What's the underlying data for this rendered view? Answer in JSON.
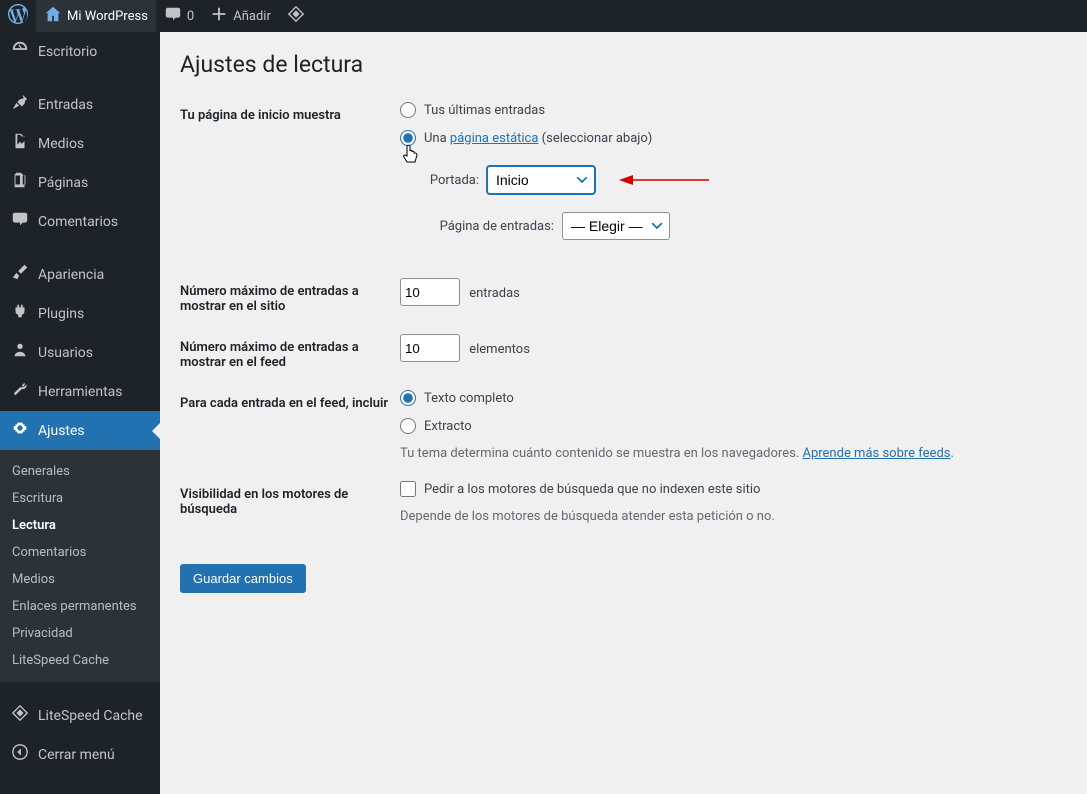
{
  "adminbar": {
    "wp_logo": "W",
    "site_name": "Mi WordPress",
    "comments_count": "0",
    "new_label": "Añadir"
  },
  "sidebar": {
    "items": [
      {
        "icon": "dashboard",
        "label": "Escritorio"
      },
      {
        "icon": "pin",
        "label": "Entradas"
      },
      {
        "icon": "media",
        "label": "Medios"
      },
      {
        "icon": "page",
        "label": "Páginas"
      },
      {
        "icon": "comment",
        "label": "Comentarios"
      },
      {
        "icon": "brush",
        "label": "Apariencia"
      },
      {
        "icon": "plug",
        "label": "Plugins"
      },
      {
        "icon": "user",
        "label": "Usuarios"
      },
      {
        "icon": "wrench",
        "label": "Herramientas"
      },
      {
        "icon": "settings",
        "label": "Ajustes"
      }
    ],
    "submenu": [
      "Generales",
      "Escritura",
      "Lectura",
      "Comentarios",
      "Medios",
      "Enlaces permanentes",
      "Privacidad",
      "LiteSpeed Cache"
    ],
    "litespeed": "LiteSpeed Cache",
    "collapse": "Cerrar menú"
  },
  "page": {
    "title": "Ajustes de lectura",
    "homepage": {
      "label": "Tu página de inicio muestra",
      "opt_latest": "Tus últimas entradas",
      "opt_static_prefix": "Una ",
      "opt_static_link": "página estática",
      "opt_static_suffix": " (seleccionar abajo)",
      "front_label": "Portada:",
      "front_value": "Inicio",
      "posts_label": "Página de entradas:",
      "posts_value": "— Elegir —"
    },
    "posts_per_page": {
      "label": "Número máximo de entradas a mostrar en el sitio",
      "value": "10",
      "suffix": "entradas"
    },
    "posts_per_rss": {
      "label": "Número máximo de entradas a mostrar en el feed",
      "value": "10",
      "suffix": "elementos"
    },
    "feed_content": {
      "label": "Para cada entrada en el feed, incluir",
      "opt_full": "Texto completo",
      "opt_excerpt": "Extracto",
      "description_prefix": "Tu tema determina cuánto contenido se muestra en los navegadores. ",
      "description_link": "Aprende más sobre feeds"
    },
    "search_visibility": {
      "label": "Visibilidad en los motores de búsqueda",
      "checkbox_label": "Pedir a los motores de búsqueda que no indexen este sitio",
      "description": "Depende de los motores de búsqueda atender esta petición o no."
    },
    "save_button": "Guardar cambios"
  }
}
